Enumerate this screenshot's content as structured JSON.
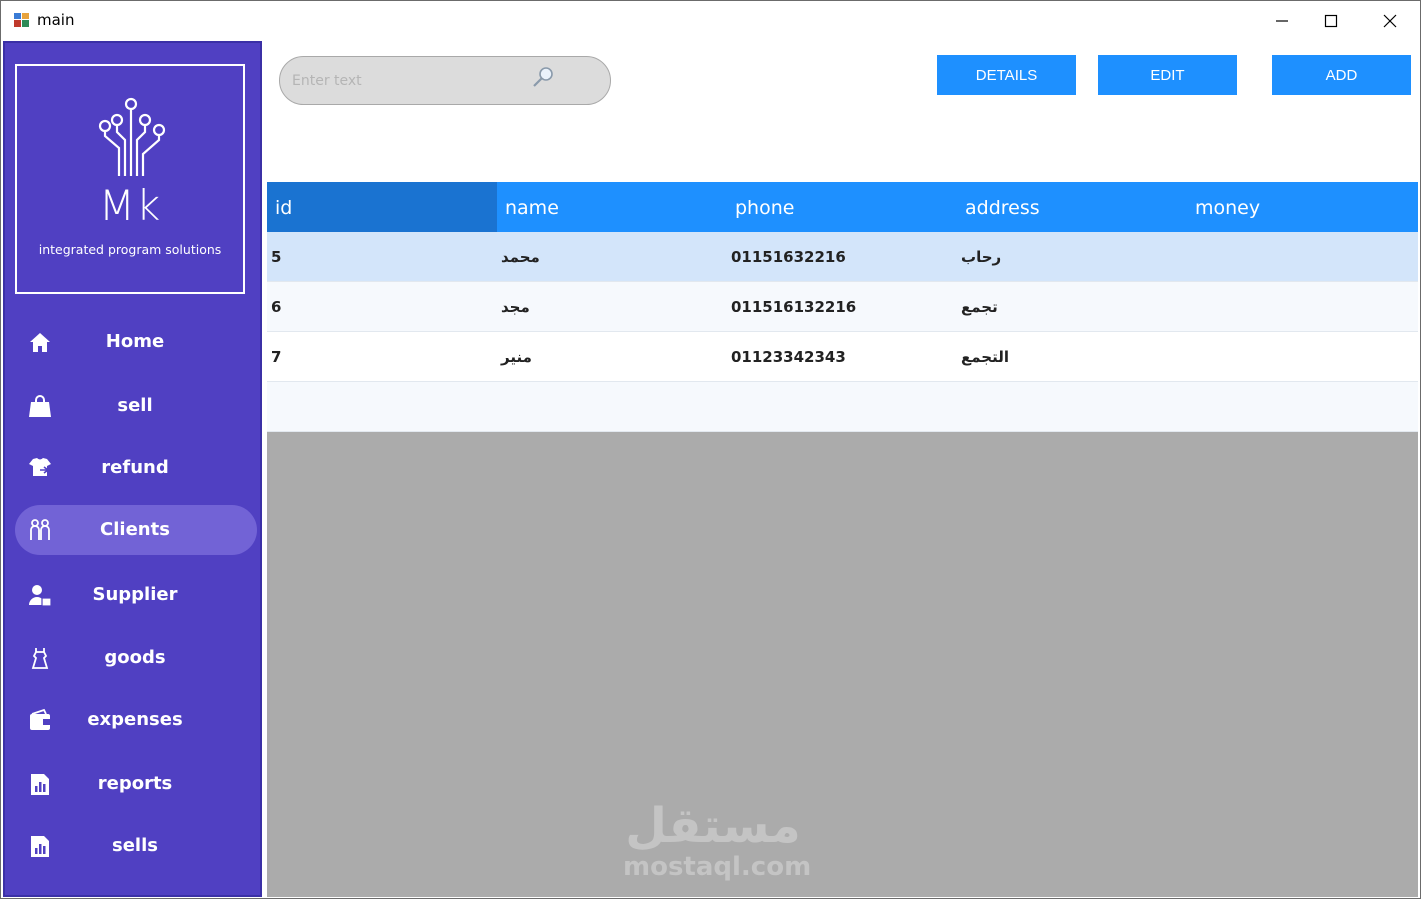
{
  "window": {
    "title": "main"
  },
  "logo": {
    "mark": "Mk",
    "tagline": "integrated program solutions"
  },
  "sidebar": {
    "items": [
      {
        "label": "Home",
        "icon": "home-icon"
      },
      {
        "label": "sell",
        "icon": "shopping-bag-icon"
      },
      {
        "label": "refund",
        "icon": "refund-icon"
      },
      {
        "label": "Clients",
        "icon": "clients-icon",
        "active": true
      },
      {
        "label": "Supplier",
        "icon": "supplier-icon"
      },
      {
        "label": "goods",
        "icon": "goods-icon"
      },
      {
        "label": "expenses",
        "icon": "wallet-icon"
      },
      {
        "label": "reports",
        "icon": "report-icon"
      },
      {
        "label": "sells",
        "icon": "report-icon"
      }
    ],
    "active_color": "#7263d6",
    "bg_color": "#5040c2"
  },
  "search": {
    "placeholder": "Enter text",
    "value": ""
  },
  "toolbar": {
    "details_label": "DETAILS",
    "edit_label": "EDIT",
    "add_label": "ADD",
    "button_color": "#1e90ff"
  },
  "table": {
    "columns": [
      "id",
      "name",
      "phone",
      "address",
      "money"
    ],
    "rows": [
      {
        "id": "5",
        "name": "محمد",
        "phone": "01151632216",
        "address": "رحاب",
        "money": ""
      },
      {
        "id": "6",
        "name": "مجد",
        "phone": "011516132216",
        "address": "تجمع",
        "money": ""
      },
      {
        "id": "7",
        "name": "منير",
        "phone": "01123342343",
        "address": "التجمع",
        "money": ""
      }
    ],
    "header_color": "#1e90ff",
    "selected_row_color": "#d3e5fa"
  },
  "watermark": {
    "arabic": "مستقل",
    "latin": "mostaql.com"
  }
}
